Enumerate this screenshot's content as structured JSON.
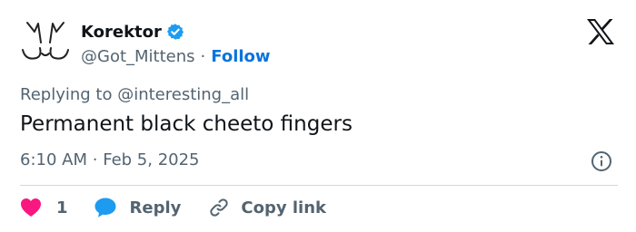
{
  "author": {
    "name": "Korektor",
    "handle": "@Got_Mittens",
    "separator": "·",
    "follow_label": "Follow",
    "verified_color": "#1d9bf0"
  },
  "reply_to": {
    "prefix": "Replying to",
    "mention": "@interesting_all"
  },
  "tweet": {
    "text": "Permanent black cheeto fingers",
    "time": "6:10 AM",
    "separator": "·",
    "date": "Feb 5, 2025"
  },
  "actions": {
    "like_count": "1",
    "reply_label": "Reply",
    "copy_label": "Copy link"
  },
  "icons": {
    "avatar": "cat-ears-avatar-icon",
    "verified": "verified-badge-icon",
    "brand": "x-logo-icon",
    "info": "info-icon",
    "like": "heart-icon",
    "reply": "speech-bubble-icon",
    "copy": "link-icon"
  },
  "colors": {
    "text": "#0f1419",
    "muted": "#536471",
    "follow": "#0a74da",
    "like": "#f91880",
    "reply": "#1d9bf0"
  }
}
